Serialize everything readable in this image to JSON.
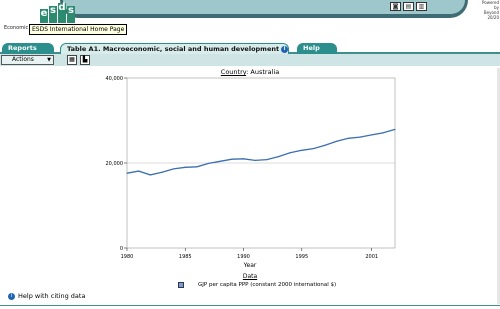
{
  "header": {
    "logo_letters": [
      "e",
      "s",
      "d",
      "s"
    ],
    "logo_caption": "Economic an",
    "tooltip": "ESDS International Home Page",
    "tools": [
      "camera-icon",
      "export-icon",
      "print-icon"
    ],
    "powered_by": [
      "Powered",
      "by",
      "Beyond",
      "20/20"
    ]
  },
  "tabs": {
    "reports": "Reports",
    "table": "Table A1. Macroeconomic, social and human development",
    "help": "Help"
  },
  "toolbar": {
    "actions": "Actions"
  },
  "country": {
    "label": "Country",
    "value": "Australia"
  },
  "chart_data": {
    "type": "line",
    "xlabel": "Year",
    "ylabel": "",
    "x": [
      1980,
      1981,
      1982,
      1983,
      1984,
      1985,
      1986,
      1987,
      1988,
      1989,
      1990,
      1991,
      1992,
      1993,
      1994,
      1995,
      1996,
      1997,
      1998,
      1999,
      2000,
      2001,
      2002,
      2003
    ],
    "series": [
      {
        "name": "GDP per capita, PPP (constant 2000 international $)",
        "values": [
          17600,
          18100,
          17200,
          17800,
          18600,
          19000,
          19100,
          19900,
          20400,
          20900,
          21000,
          20600,
          20800,
          21500,
          22400,
          23000,
          23400,
          24200,
          25100,
          25800,
          26100,
          26600,
          27100,
          27900
        ]
      }
    ],
    "yticks": [
      0,
      20000,
      40000
    ],
    "ytick_labels": [
      "0",
      "20,000",
      "40,000"
    ],
    "xticks": [
      1980,
      1985,
      1990,
      1995,
      2001
    ],
    "ylim": [
      0,
      40000
    ],
    "xlim": [
      1980,
      2003
    ],
    "grid": "horizontal at 20,000",
    "color": "#3b6fb0"
  },
  "data_heading": "Data",
  "legend_label": "GJP per capita PPP (constant 2000 international $)",
  "footer": {
    "help_link": "Help with citing data"
  }
}
